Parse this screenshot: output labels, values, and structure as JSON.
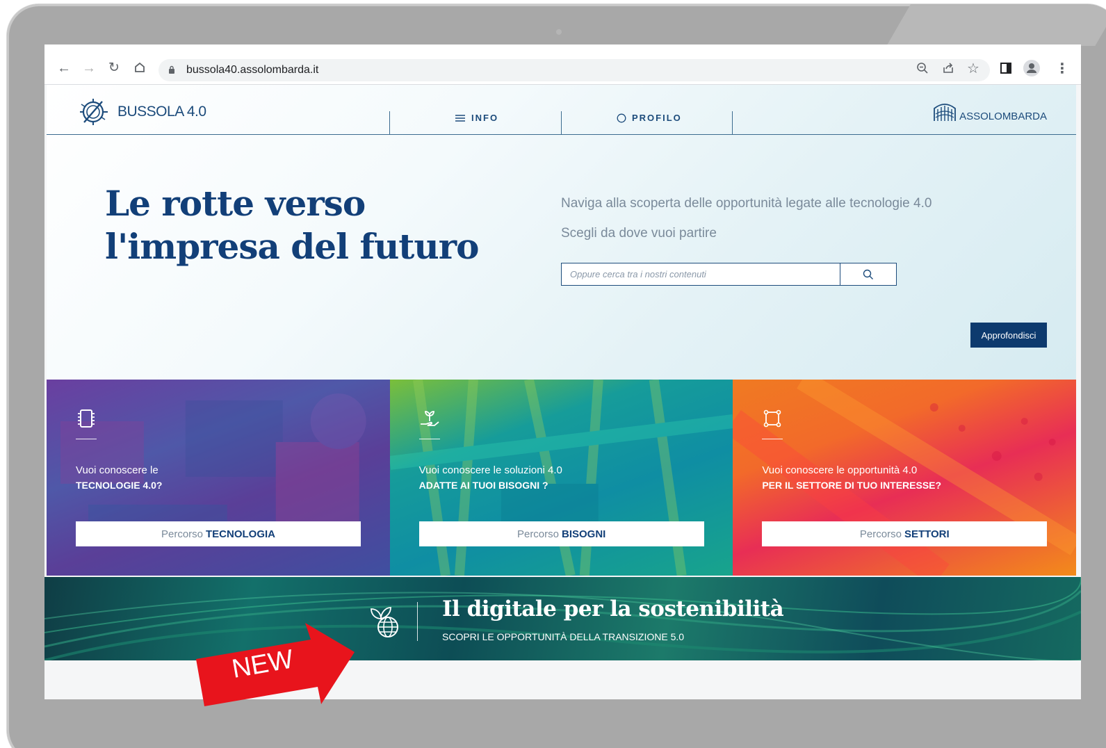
{
  "browser": {
    "url": "bussola40.assolombarda.it"
  },
  "site": {
    "logo_text": "BUSSOLA 4.0",
    "nav": {
      "info": "INFO",
      "profilo": "PROFILO"
    },
    "partner_logo_text": "ASSOLOMBARDA",
    "hero": {
      "headline_line1": "Le rotte verso",
      "headline_line2": "l'impresa del futuro",
      "intro": "Naviga alla scoperta delle opportunità legate alle tecnologie 4.0",
      "intro2": "Scegli da dove vuoi partire",
      "search_placeholder": "Oppure cerca tra i nostri contenuti",
      "cta": "Approfondisci"
    },
    "cards": [
      {
        "q1": "Vuoi conoscere le",
        "q2": "TECNOLOGIE 4.0?",
        "btn_prefix": "Percorso",
        "btn_bold": "TECNOLOGIA"
      },
      {
        "q1": "Vuoi conoscere le soluzioni 4.0",
        "q2": "ADATTE AI TUOI BISOGNI ?",
        "btn_prefix": "Percorso",
        "btn_bold": "BISOGNI"
      },
      {
        "q1": "Vuoi conoscere le opportunità 4.0",
        "q2": "PER IL SETTORE DI TUO INTERESSE?",
        "btn_prefix": "Percorso",
        "btn_bold": "SETTORI"
      }
    ],
    "banner": {
      "title": "Il digitale per la sostenibilità",
      "subtitle": "SCOPRI LE OPPORTUNITÀ DELLA TRANSIZIONE 5.0"
    }
  },
  "annotation": {
    "label": "NEW",
    "color": "#e8141c"
  },
  "colors": {
    "brand_navy": "#123f78",
    "cta_navy": "#0d3a6e",
    "card_purple": "#5a3f98",
    "card_teal": "#0f8ea3",
    "card_orange": "#f07a22"
  }
}
